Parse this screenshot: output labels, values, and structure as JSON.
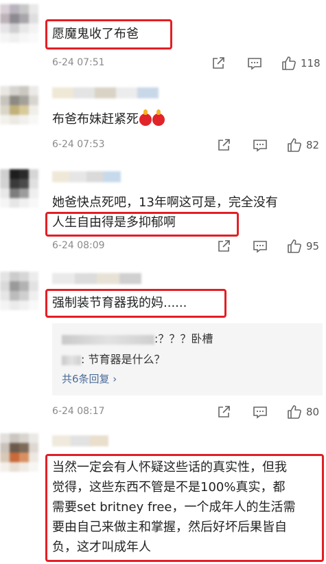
{
  "comments": [
    {
      "text": "愿魔鬼收了布爸",
      "time": "6-24 07:51",
      "likes": "118"
    },
    {
      "text": "布爸布妹赶紧死",
      "time": "6-24 07:53",
      "likes": "82",
      "emoji": "candle-icon"
    },
    {
      "text_line1": "她爸快点死吧，13年啊这可是，完全没有",
      "text_line2": "人生自由得是多抑郁啊",
      "time": "6-24 08:09",
      "likes": "95"
    },
    {
      "text": "强制装节育器我的妈......",
      "time": "6-24 08:17",
      "likes": "80",
      "replies": [
        {
          "text": ":？？？卧槽"
        },
        {
          "text": ": 节育器是什么？"
        }
      ],
      "reply_more": "共6条回复 ›"
    },
    {
      "lines": [
        "当然一定会有人怀疑这些话的真实性，但我",
        "觉得，这些东西不管是不是100%真实，都",
        "需要set britney free，一个成年人的生活需",
        "要由自己来做主和掌握，然后好坏后果皆自",
        "负，这才叫成年人"
      ]
    }
  ],
  "colors": {
    "highlight": "#e31e24",
    "meta": "#8a8a8a",
    "link": "#4a6b9a"
  },
  "icons": {
    "share": "share-icon",
    "comment": "comment-icon",
    "like": "like-icon"
  }
}
